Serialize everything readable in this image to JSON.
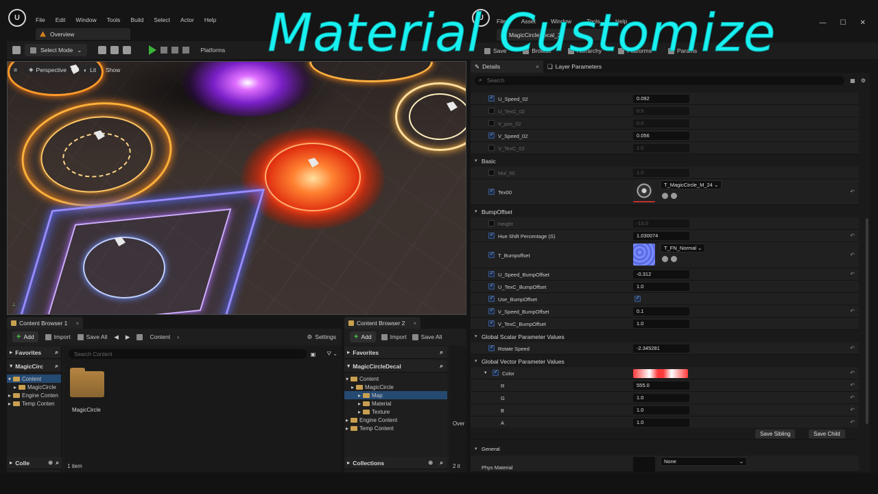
{
  "overlay_title": "Material Customize",
  "left": {
    "menu": [
      "File",
      "Edit",
      "Window",
      "Tools",
      "Build",
      "Select",
      "Actor",
      "Help"
    ],
    "tab": "Overview",
    "toolbar": {
      "select_mode": "Select Mode",
      "platforms": "Platforms"
    },
    "viewport": {
      "perspective": "Perspective",
      "lit": "Lit",
      "show": "Show"
    },
    "cb1": {
      "tab": "Content Browser 1",
      "add": "Add",
      "import": "Import",
      "save_all": "Save All",
      "path": "Content",
      "settings": "Settings",
      "favorites": "Favorites",
      "project": "MagicCirc",
      "tree": [
        "Content",
        "MagicCircle",
        "Engine Conten",
        "Temp Conten"
      ],
      "collections": "Colle",
      "search_placeholder": "Search Content",
      "folder_label": "MagicCircle",
      "item_count": "1 item"
    },
    "cb2": {
      "tab": "Content Browser 2",
      "add": "Add",
      "import": "Import",
      "save_all": "Save All",
      "favorites": "Favorites",
      "project": "MagicCircleDecal",
      "tree": [
        "Content",
        "MagicCircle",
        "Map",
        "Material",
        "Texture",
        "Engine Content",
        "Temp Content"
      ],
      "collections": "Collections",
      "over": "Over",
      "count": "2 it"
    }
  },
  "right": {
    "menu": [
      "File",
      "Asset",
      "Window",
      "Tools",
      "Help"
    ],
    "tab": "MagicCircleDecal_2",
    "toolbar": [
      "Save",
      "Browse",
      "Hierarchy",
      "Platforms",
      "Params"
    ],
    "details_tab": "Details",
    "layer_tab": "Layer Parameters",
    "search_placeholder": "Search",
    "rows": [
      {
        "type": "prop",
        "name": "U_Speed_02",
        "value": "0.092",
        "on": true
      },
      {
        "type": "prop",
        "name": "U_TexC_02",
        "value": "0.5",
        "on": false
      },
      {
        "type": "prop",
        "name": "V_pos_02",
        "value": "0.0",
        "on": false
      },
      {
        "type": "prop",
        "name": "V_Speed_02",
        "value": "0.056",
        "on": true
      },
      {
        "type": "prop",
        "name": "V_TexC_02",
        "value": "1.0",
        "on": false
      },
      {
        "type": "cat",
        "name": "Basic"
      },
      {
        "type": "prop",
        "name": "Mul_00",
        "value": "1.0",
        "on": false
      },
      {
        "type": "tex",
        "name": "Tex00",
        "value": "T_MagicCircle_M_24",
        "on": true,
        "thumb": "dark"
      },
      {
        "type": "cat",
        "name": "BumpOffset"
      },
      {
        "type": "prop",
        "name": "Height",
        "value": "-15.0",
        "on": false
      },
      {
        "type": "prop",
        "name": "Hue Shift Percentage (S)",
        "value": "1.030074",
        "on": true,
        "reset": true
      },
      {
        "type": "tex",
        "name": "T_Bumpoffset",
        "value": "T_FN_Normal",
        "on": true,
        "thumb": "normal"
      },
      {
        "type": "prop",
        "name": "U_Speed_BumpOffset",
        "value": "-0.312",
        "on": true,
        "reset": true
      },
      {
        "type": "prop",
        "name": "U_TexC_BumpOffset",
        "value": "1.0",
        "on": true
      },
      {
        "type": "bool",
        "name": "Use_BumpOffset",
        "on": true
      },
      {
        "type": "prop",
        "name": "V_Speed_BumpOffset",
        "value": "0.1",
        "on": true,
        "reset": true
      },
      {
        "type": "prop",
        "name": "V_TexC_BumpOffset",
        "value": "1.0",
        "on": true
      },
      {
        "type": "cat",
        "name": "Global Scalar Parameter Values"
      },
      {
        "type": "prop",
        "name": "Rotate Speed",
        "value": "-2.345281",
        "on": true,
        "reset": true
      },
      {
        "type": "cat",
        "name": "Global Vector Parameter Values"
      },
      {
        "type": "color",
        "name": "Color",
        "on": true,
        "reset": true
      },
      {
        "type": "chan",
        "name": "R",
        "value": "555.0"
      },
      {
        "type": "chan",
        "name": "G",
        "value": "1.0"
      },
      {
        "type": "chan",
        "name": "B",
        "value": "1.0"
      },
      {
        "type": "chan",
        "name": "A",
        "value": "1.0"
      }
    ],
    "save_sibling": "Save Sibling",
    "save_child": "Save Child",
    "general": "General",
    "phys_material": "Phys Material",
    "phys_value": "None"
  }
}
